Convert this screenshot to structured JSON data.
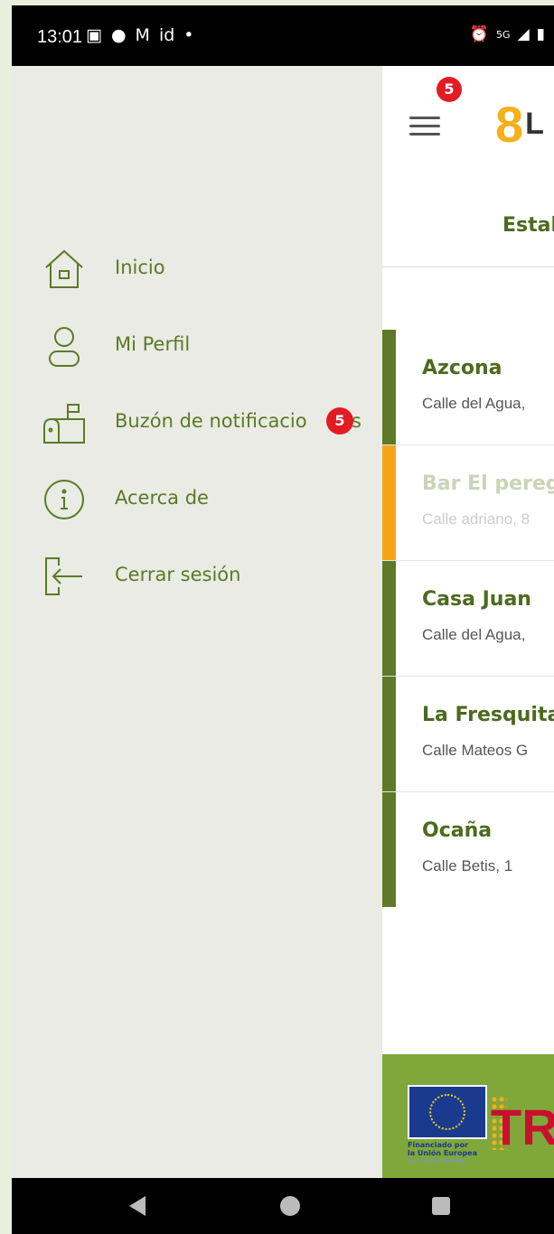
{
  "status_bar": {
    "time": "13:01",
    "left_icons": [
      "teams-icon",
      "facebook-icon",
      "gmail-icon",
      "id-icon",
      "dot-icon"
    ],
    "left_icon_glyphs": [
      "▣",
      "●",
      "M",
      "id",
      "•"
    ],
    "right_icons": [
      "alarm-icon",
      "5g-icon",
      "signal-icon",
      "battery-icon"
    ],
    "right_icon_glyphs": [
      "⏰",
      "5G",
      "◢",
      "▮"
    ]
  },
  "header": {
    "menu_badge": "5",
    "logo_mark": "8",
    "logo_text": "L",
    "title": "Estal"
  },
  "drawer": {
    "items": [
      {
        "label": "Inicio",
        "icon": "home-icon"
      },
      {
        "label": "Mi Perfil",
        "icon": "user-icon"
      },
      {
        "label": "Buzón de notificacio",
        "label_tail": "s",
        "icon": "mailbox-icon",
        "badge": "5"
      },
      {
        "label": "Acerca de",
        "icon": "info-icon"
      },
      {
        "label": "Cerrar sesión",
        "icon": "logout-icon"
      }
    ]
  },
  "establishments": [
    {
      "name": "Azcona",
      "address": "Calle del Agua,",
      "status_color": "#5e7a26",
      "name_color": "#4d6a1f",
      "addr_color": "#555555"
    },
    {
      "name": "Bar El pereg",
      "address": "Calle adriano, 8",
      "status_color": "#f4a41a",
      "name_color": "#c9d5b6",
      "addr_color": "#cccccc"
    },
    {
      "name": "Casa Juan",
      "address": "Calle del Agua,",
      "status_color": "#5e7a26",
      "name_color": "#4d6a1f",
      "addr_color": "#555555"
    },
    {
      "name": "La Fresquita",
      "address": "Calle Mateos G",
      "status_color": "#5e7a26",
      "name_color": "#4d6a1f",
      "addr_color": "#555555"
    },
    {
      "name": "Ocaña",
      "address": "Calle Betis, 1",
      "status_color": "#5e7a26",
      "name_color": "#4d6a1f",
      "addr_color": "#555555"
    }
  ],
  "footer": {
    "eu_text_line1": "Financiado por",
    "eu_text_line2": "la Unión Europea",
    "eu_text_line3": "NextGenerationEU",
    "tr_mark": "TR"
  },
  "colors": {
    "accent_green": "#5b7a25",
    "badge_red": "#e31b23",
    "logo_yellow": "#f5b01a",
    "drawer_bg": "#e9ebe4"
  }
}
